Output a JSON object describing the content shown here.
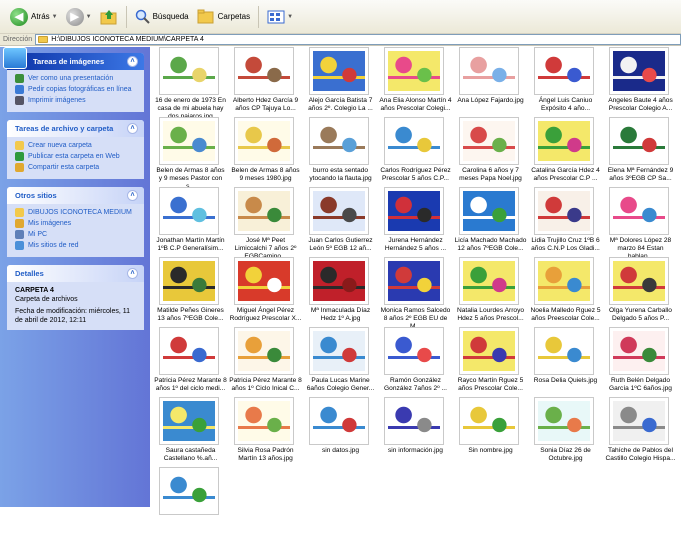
{
  "toolbar": {
    "back_label": "Atrás",
    "search_label": "Búsqueda",
    "folders_label": "Carpetas"
  },
  "address": {
    "label": "Dirección",
    "path": "H:\\DIBUJOS ICONOTECA MEDIUM\\CARPETA 4"
  },
  "sidebar": {
    "image_tasks": {
      "title": "Tareas de imágenes",
      "items": [
        {
          "label": "Ver como una presentación",
          "color": "#3b8f3b"
        },
        {
          "label": "Pedir copias fotográficas en línea",
          "color": "#3a7ad6"
        },
        {
          "label": "Imprimir imágenes",
          "color": "#556"
        }
      ]
    },
    "file_tasks": {
      "title": "Tareas de archivo y carpeta",
      "items": [
        {
          "label": "Crear nueva carpeta",
          "color": "#f2c94c"
        },
        {
          "label": "Publicar esta carpeta en Web",
          "color": "#2f9a3c"
        },
        {
          "label": "Compartir esta carpeta",
          "color": "#e0a830"
        }
      ]
    },
    "other_places": {
      "title": "Otros sitios",
      "items": [
        {
          "label": "DIBUJOS ICONOTECA MEDIUM",
          "color": "#f2c94c"
        },
        {
          "label": "Mis imágenes",
          "color": "#e0a830"
        },
        {
          "label": "Mi PC",
          "color": "#5e7fb8"
        },
        {
          "label": "Mis sitios de red",
          "color": "#4a90d9"
        }
      ]
    },
    "details": {
      "title": "Detalles",
      "name": "CARPETA 4",
      "type": "Carpeta de archivos",
      "modified": "Fecha de modificación: miércoles, 11 de abril de 2012, 12:11"
    }
  },
  "files": [
    {
      "name": "16 de enero de 1973 En casa de mi abuela hay dos pajaros.jpg",
      "colors": [
        "#ffffff",
        "#5ba84a",
        "#e8d46a"
      ]
    },
    {
      "name": "Alberto Hdez García 9 años CP Tajuya Lo...",
      "colors": [
        "#ffffff",
        "#c44a3a",
        "#8a6a4a"
      ]
    },
    {
      "name": "Alejo García Batista 7 años 2º. Colegio La ...",
      "colors": [
        "#3a6fd0",
        "#f2d23a",
        "#d03a3a"
      ]
    },
    {
      "name": "Ana Elia Alonso Martín 4 años Prescolar Colegi...",
      "colors": [
        "#f4e86a",
        "#e84a8a",
        "#6ac04a"
      ]
    },
    {
      "name": "Ana López Fajardo.jpg",
      "colors": [
        "#ffffff",
        "#e8a0a0",
        "#7ab0e8"
      ]
    },
    {
      "name": "Ángel Luis Caniuo Expósito 4 año...",
      "colors": [
        "#ffffff",
        "#d03a3a",
        "#3a5ad0"
      ]
    },
    {
      "name": "Angeles Baute 4 años Prescolar Colegio A...",
      "colors": [
        "#1a2a8a",
        "#f2f2f2",
        "#e84a4a"
      ]
    },
    {
      "name": "Belen de Armas 8 años y 9 meses Pastor con s...",
      "colors": [
        "#fffbe8",
        "#6ab04a",
        "#4a8ad0"
      ]
    },
    {
      "name": "Belen de Armas 8 años 9 meses 1980.jpg",
      "colors": [
        "#fffbe8",
        "#e8c84a",
        "#d06a3a"
      ]
    },
    {
      "name": "burro esta sentado ytocando la flauta.jpg",
      "colors": [
        "#ffffff",
        "#9a7a5a",
        "#5aa0d8"
      ]
    },
    {
      "name": "Carlos Rodríguez Pérez Prescolar 5 años C.P...",
      "colors": [
        "#ffffff",
        "#3a8ad0",
        "#e8c83a"
      ]
    },
    {
      "name": "Carolina 6 años y 7 meses Papa Noel.jpg",
      "colors": [
        "#fdf6f0",
        "#d84a4a",
        "#6ab04a"
      ]
    },
    {
      "name": "Catalina García Hdez 4 años Prescolar C.P ...",
      "colors": [
        "#f4e86a",
        "#3aa03a",
        "#d03a8a"
      ]
    },
    {
      "name": "Elena Mª Fernández 9 años 3ºEGB CP Sa...",
      "colors": [
        "#ffffff",
        "#2a7a3a",
        "#d03a3a"
      ]
    },
    {
      "name": "Jonathan Martín Martín 1ºB C.P Generalísim...",
      "colors": [
        "#ffffff",
        "#3a70d0",
        "#60c0e0"
      ]
    },
    {
      "name": "José Mª Peet Limiccalchi 7 años 2º EGBCamino...",
      "colors": [
        "#f8f0d8",
        "#c88a4a",
        "#3a8a3a"
      ]
    },
    {
      "name": "Juan Carlos Gutierrez León 5º EGB 12 añ...",
      "colors": [
        "#dfe8f8",
        "#8a3a2a",
        "#4a4a4a"
      ]
    },
    {
      "name": "Jurena Hernández Hernández 5 años ...",
      "colors": [
        "#1a3ab0",
        "#d0303a",
        "#2a2a2a"
      ]
    },
    {
      "name": "Licía Machado Machado 12 años 7ºEGB Cole...",
      "colors": [
        "#2a7ad0",
        "#ffffff",
        "#3aa03a"
      ]
    },
    {
      "name": "Lidia Trujillo Cruz 1ºB 6 años C.N.P Los Gladi...",
      "colors": [
        "#f8f0e8",
        "#d03a3a",
        "#3a3a8a"
      ]
    },
    {
      "name": "Mª Dolores López 28 marzo 84 Estan hablan...",
      "colors": [
        "#ffffff",
        "#e84a8a",
        "#3a8ad0"
      ]
    },
    {
      "name": "Matilde Peñes Gineres 13 años 7ºEGB Cole...",
      "colors": [
        "#e8c83a",
        "#2a2a2a",
        "#3a7a3a"
      ]
    },
    {
      "name": "Miguel Ángel Pérez Rodríguez Prescolar X...",
      "colors": [
        "#d83a2a",
        "#f2d23a",
        "#ffffff"
      ]
    },
    {
      "name": "Mª Inmaculada Díaz Hedz 1º A.jpg",
      "colors": [
        "#c0202a",
        "#2a2a2a",
        "#8a1a1a"
      ]
    },
    {
      "name": "Monica Ramos Salcedo 8 años 2º EGB EU de M...",
      "colors": [
        "#2a3ab0",
        "#d03a3a",
        "#f2d23a"
      ]
    },
    {
      "name": "Natalia Lourdes Arroyo Hdez 5 años Prescol...",
      "colors": [
        "#f4e86a",
        "#3aa03a",
        "#d03a8a"
      ]
    },
    {
      "name": "Noelia Malledo Rguez 5 años Preescolar Cole...",
      "colors": [
        "#f4e86a",
        "#e8a03a",
        "#3a8ad0"
      ]
    },
    {
      "name": "Olga Yurena Carballo Delgado 5 años P...",
      "colors": [
        "#f4e86a",
        "#d03a3a",
        "#3a3a3a"
      ]
    },
    {
      "name": "Patricia Pérez Marante 8 años 1º del ciclo medi...",
      "colors": [
        "#ffffff",
        "#d03a3a",
        "#3a6ad0"
      ]
    },
    {
      "name": "Patricia Pérez Marante 8 años 1º Ciclo Inical C...",
      "colors": [
        "#fdf6e8",
        "#e8a03a",
        "#3a8a3a"
      ]
    },
    {
      "name": "Paula Lucas Marine 6años Colegio Gener...",
      "colors": [
        "#e8f0f8",
        "#3a8ad0",
        "#d03a3a"
      ]
    },
    {
      "name": "Ramón González González 7años 2º ...",
      "colors": [
        "#ffffff",
        "#3a5ad0",
        "#e84a4a"
      ]
    },
    {
      "name": "Rayco Martín Rguez 5 años Prescolar Cole...",
      "colors": [
        "#f4e86a",
        "#d03a3a",
        "#3a3ab0"
      ]
    },
    {
      "name": "Rosa Delia Quiels.jpg",
      "colors": [
        "#ffffff",
        "#e8c83a",
        "#3a8ad0"
      ]
    },
    {
      "name": "Ruth Belén Delgado García 1ºC 6años.jpg",
      "colors": [
        "#fdf0f0",
        "#d03a5a",
        "#3a8a3a"
      ]
    },
    {
      "name": "Saura castañeda Castellano %.añ...",
      "colors": [
        "#3a8ad0",
        "#f4e86a",
        "#3aa03a"
      ]
    },
    {
      "name": "Silvia Rosa Padrón Martín 13 años.jpg",
      "colors": [
        "#fffbe8",
        "#e87a4a",
        "#6ab04a"
      ]
    },
    {
      "name": "sin datos.jpg",
      "colors": [
        "#ffffff",
        "#3a8ad0",
        "#d03a3a"
      ]
    },
    {
      "name": "sin información.jpg",
      "colors": [
        "#ffffff",
        "#3a3ab0",
        "#8a8a8a"
      ]
    },
    {
      "name": "Sin nombre.jpg",
      "colors": [
        "#ffffff",
        "#e8c83a",
        "#3aa03a"
      ]
    },
    {
      "name": "Sonia Díaz 26 de Octubre.jpg",
      "colors": [
        "#e8f8f8",
        "#6ab04a",
        "#e87a4a"
      ]
    },
    {
      "name": "Tahíche de Pablos del Castillo Colegio Hispa...",
      "colors": [
        "#f0f0f0",
        "#8a8a8a",
        "#3a6ad0"
      ]
    },
    {
      "name": "",
      "colors": [
        "#ffffff",
        "#3a8ad0",
        "#3aa03a"
      ]
    }
  ]
}
